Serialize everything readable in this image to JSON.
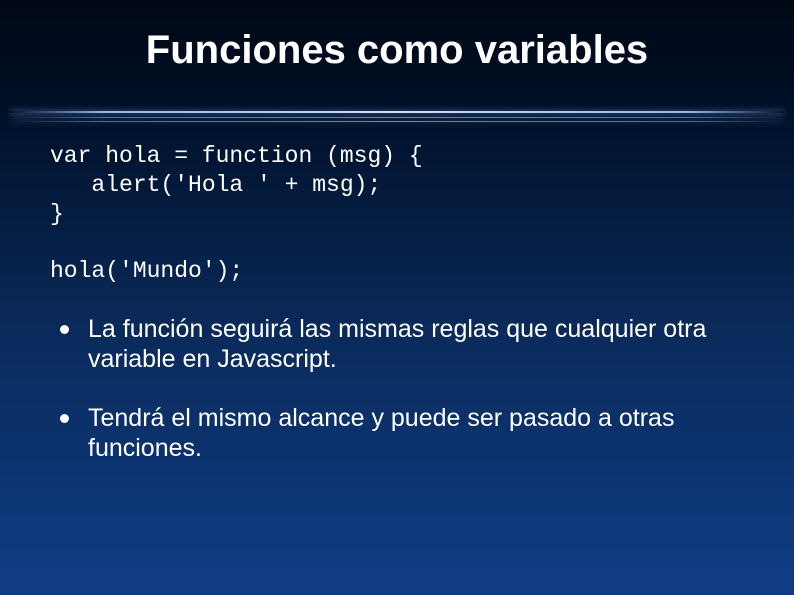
{
  "title": "Funciones como variables",
  "code": "var hola = function (msg) {\n   alert('Hola ' + msg);\n}\n\nhola('Mundo');",
  "bullets": [
    "La función seguirá las mismas reglas que cualquier otra variable en Javascript.",
    "Tendrá el mismo alcance y puede ser pasado a otras funciones."
  ]
}
